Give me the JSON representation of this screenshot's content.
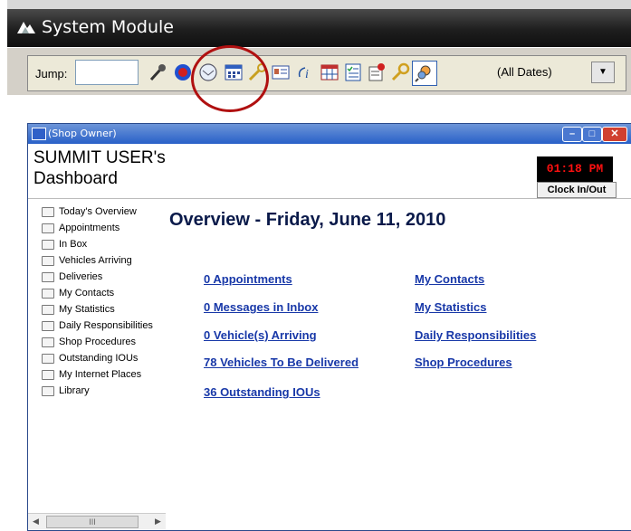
{
  "app": {
    "title": "System Module"
  },
  "toolbar": {
    "jump_label": "Jump:",
    "jump_value": "",
    "dates_label": "(All Dates)",
    "icons": [
      "pin-icon",
      "globe-icon",
      "mail-icon",
      "calendar-icon",
      "key-icon",
      "card-icon",
      "info-icon",
      "grid-icon",
      "checklist-icon",
      "notepad-icon",
      "keys-icon",
      "search-icon"
    ]
  },
  "window": {
    "title": "(Shop Owner)"
  },
  "dashboard": {
    "title_line1": "SUMMIT USER's",
    "title_line2": "Dashboard",
    "clock": "01:18 PM",
    "clock_button": "Clock In/Out",
    "heading": "Overview - Friday, June 11, 2010"
  },
  "sidebar": {
    "items": [
      {
        "label": "Today's Overview"
      },
      {
        "label": "Appointments"
      },
      {
        "label": "In Box"
      },
      {
        "label": "Vehicles Arriving"
      },
      {
        "label": "Deliveries"
      },
      {
        "label": "My Contacts"
      },
      {
        "label": "My Statistics"
      },
      {
        "label": "Daily Responsibilities"
      },
      {
        "label": "Shop Procedures"
      },
      {
        "label": "Outstanding IOUs"
      },
      {
        "label": "My Internet Places"
      },
      {
        "label": "Library"
      }
    ]
  },
  "links": {
    "left": [
      "0 Appointments",
      "0 Messages in Inbox",
      "0 Vehicle(s) Arriving",
      "78 Vehicles To Be Delivered",
      "36 Outstanding IOUs"
    ],
    "right": [
      "My Contacts",
      "My Statistics",
      "Daily Responsibilities",
      "Shop Procedures"
    ]
  },
  "colors": {
    "accent_red": "#b01010",
    "link_blue": "#1838a8",
    "clock_red": "#ff1010"
  }
}
